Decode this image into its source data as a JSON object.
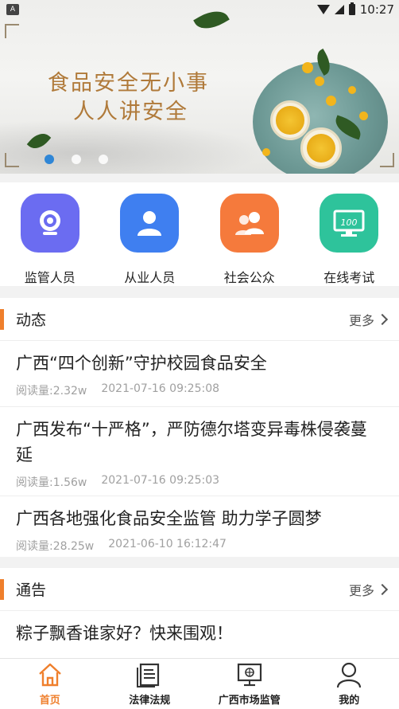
{
  "status_bar": {
    "time": "10:27"
  },
  "banner": {
    "slogan_line1": "食品安全无小事",
    "slogan_line2": "人人讲安全",
    "indicator_count": 3,
    "active_index": 0
  },
  "quick_menu": [
    {
      "label": "监管人员",
      "icon": "webcam-icon",
      "color": "#6b6cf1"
    },
    {
      "label": "从业人员",
      "icon": "person-icon",
      "color": "#3f7ff0"
    },
    {
      "label": "社会公众",
      "icon": "group-icon",
      "color": "#f57a3c"
    },
    {
      "label": "在线考试",
      "icon": "exam-monitor-icon",
      "color": "#2ec39b"
    }
  ],
  "news": {
    "title": "动态",
    "more": "更多",
    "items": [
      {
        "headline": "广西“四个创新”守护校园食品安全",
        "reads": "阅读量:2.32w",
        "time": "2021-07-16 09:25:08"
      },
      {
        "headline": "广西发布“十严格”，严防德尔塔变异毒株侵袭蔓延",
        "reads": "阅读量:1.56w",
        "time": "2021-07-16 09:25:03"
      },
      {
        "headline": "广西各地强化食品安全监管 助力学子圆梦",
        "reads": "阅读量:28.25w",
        "time": "2021-06-10 16:12:47"
      }
    ]
  },
  "notice": {
    "title": "通告",
    "more": "更多",
    "items": [
      {
        "headline": "粽子飘香谁家好？快来围观！"
      }
    ]
  },
  "bottom_nav": [
    {
      "label": "首页",
      "icon": "home-icon",
      "active": true
    },
    {
      "label": "法律法规",
      "icon": "document-icon",
      "active": false
    },
    {
      "label": "广西市场监管",
      "icon": "monitor-globe-icon",
      "active": false
    },
    {
      "label": "我的",
      "icon": "profile-icon",
      "active": false
    }
  ],
  "colors": {
    "accent": "#ef7f2c",
    "indicator_active": "#2f86d6"
  }
}
